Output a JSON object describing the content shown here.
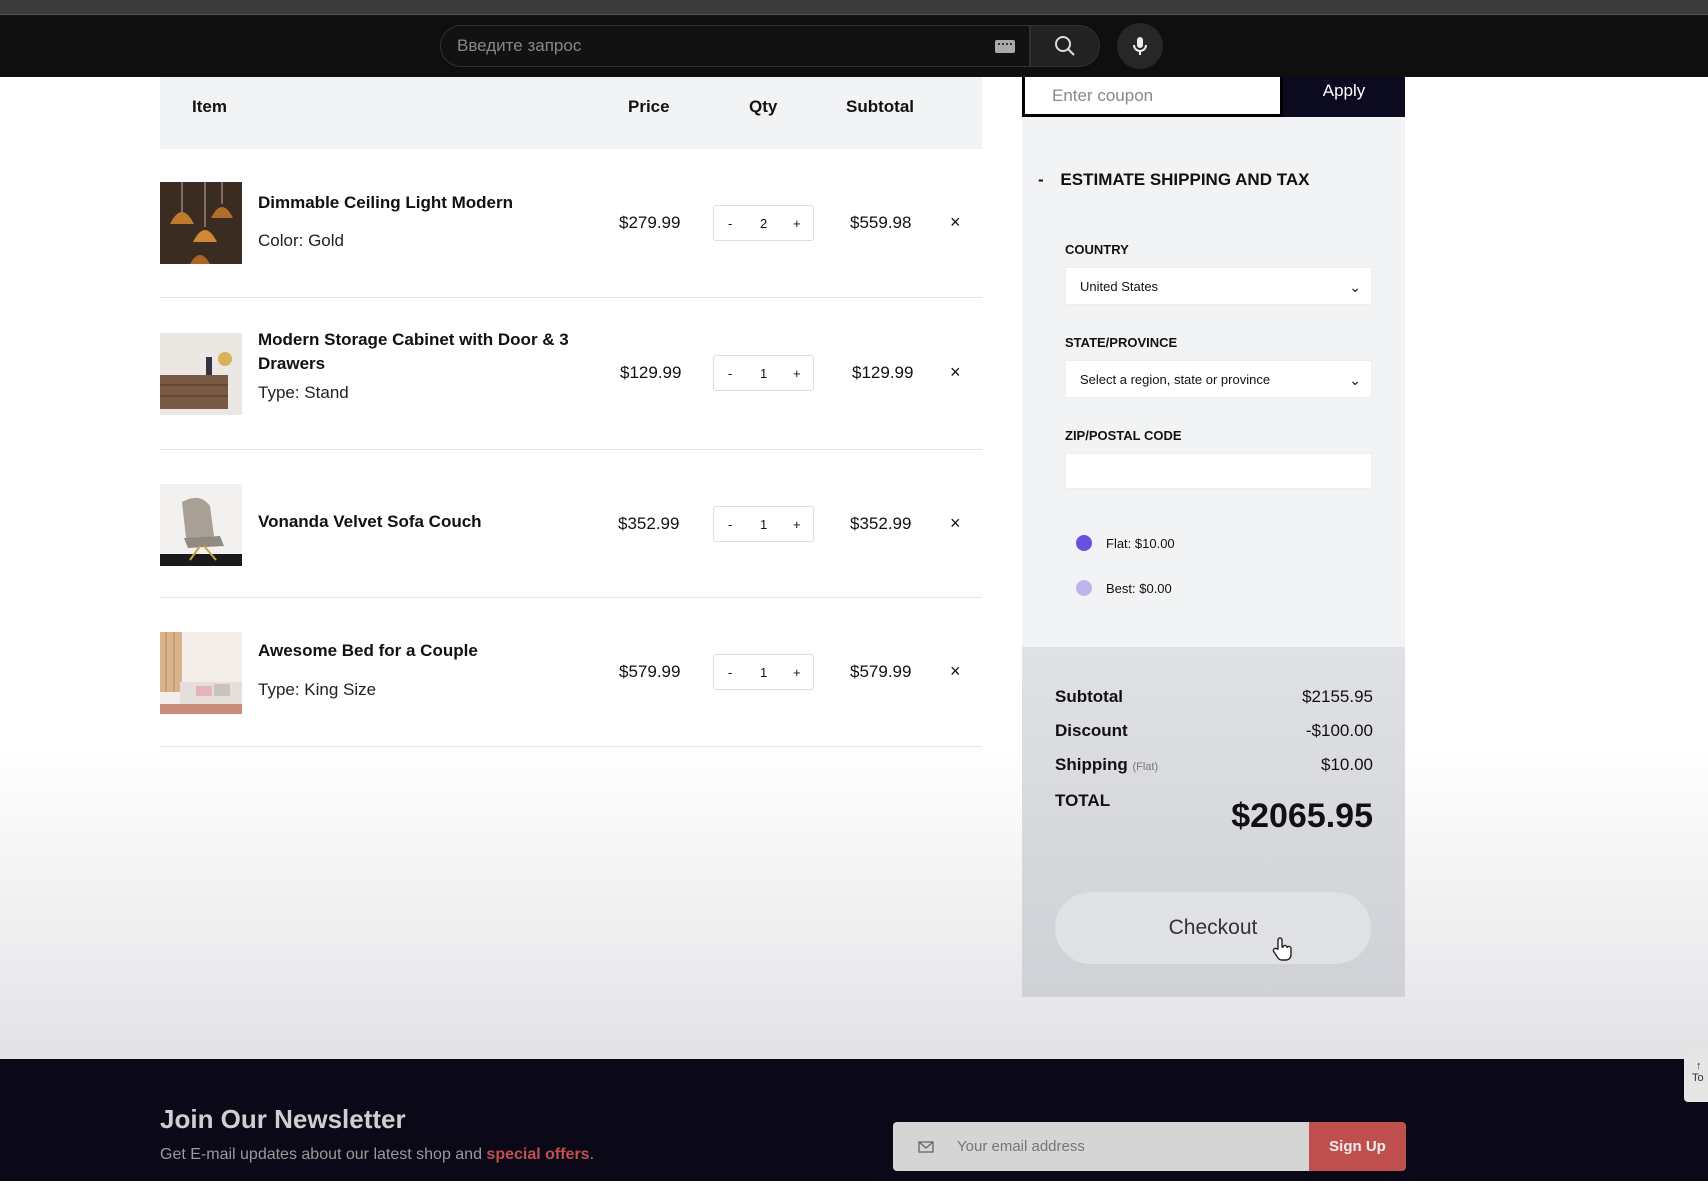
{
  "browser": {
    "search_placeholder": "Введите запрос",
    "icons": {
      "keyboard": "keyboard-icon",
      "search": "search-icon",
      "mic": "microphone-icon"
    }
  },
  "cart": {
    "headers": {
      "item": "Item",
      "price": "Price",
      "qty": "Qty",
      "subtotal": "Subtotal"
    },
    "items": [
      {
        "name": "Dimmable Ceiling Light Modern",
        "option": "Color: Gold",
        "price": "$279.99",
        "qty": "2",
        "subtotal": "$559.98"
      },
      {
        "name": "Modern Storage Cabinet with Door & 3 Drawers",
        "option": "Type: Stand",
        "price": "$129.99",
        "qty": "1",
        "subtotal": "$129.99"
      },
      {
        "name": "Vonanda Velvet Sofa Couch",
        "option": "",
        "price": "$352.99",
        "qty": "1",
        "subtotal": "$352.99"
      },
      {
        "name": "Awesome Bed for a Couple",
        "option": "Type: King Size",
        "price": "$579.99",
        "qty": "1",
        "subtotal": "$579.99"
      }
    ],
    "minus": "-",
    "plus": "+",
    "remove": "×"
  },
  "coupon": {
    "placeholder": "Enter coupon",
    "apply_label": "Apply"
  },
  "shipping": {
    "title": "ESTIMATE SHIPPING AND TAX",
    "toggle": "-",
    "country_label": "COUNTRY",
    "country_value": "United States",
    "state_label": "STATE/PROVINCE",
    "state_value": "Select a region, state or province",
    "zip_label": "ZIP/POSTAL CODE",
    "zip_value": "",
    "rates": [
      {
        "label": "Flat: $10.00",
        "selected": true
      },
      {
        "label": "Best: $0.00",
        "selected": false
      }
    ],
    "accent_color": "#6a4fe0"
  },
  "totals": {
    "subtotal_label": "Subtotal",
    "subtotal_value": "$2155.95",
    "discount_label": "Discount",
    "discount_value": "-$100.00",
    "shipping_label": "Shipping",
    "shipping_note": "(Flat)",
    "shipping_value": "$10.00",
    "total_label": "TOTAL",
    "total_value": "$2065.95",
    "checkout_label": "Checkout"
  },
  "newsletter": {
    "title": "Join Our Newsletter",
    "subtitle_prefix": "Get E-mail updates about our latest shop and ",
    "subtitle_highlight": "special offers",
    "subtitle_suffix": ".",
    "email_placeholder": "Your email address",
    "signup_label": "Sign Up",
    "accent_color": "#c0504d"
  },
  "to_top": {
    "arrow": "↑",
    "label": "To"
  }
}
